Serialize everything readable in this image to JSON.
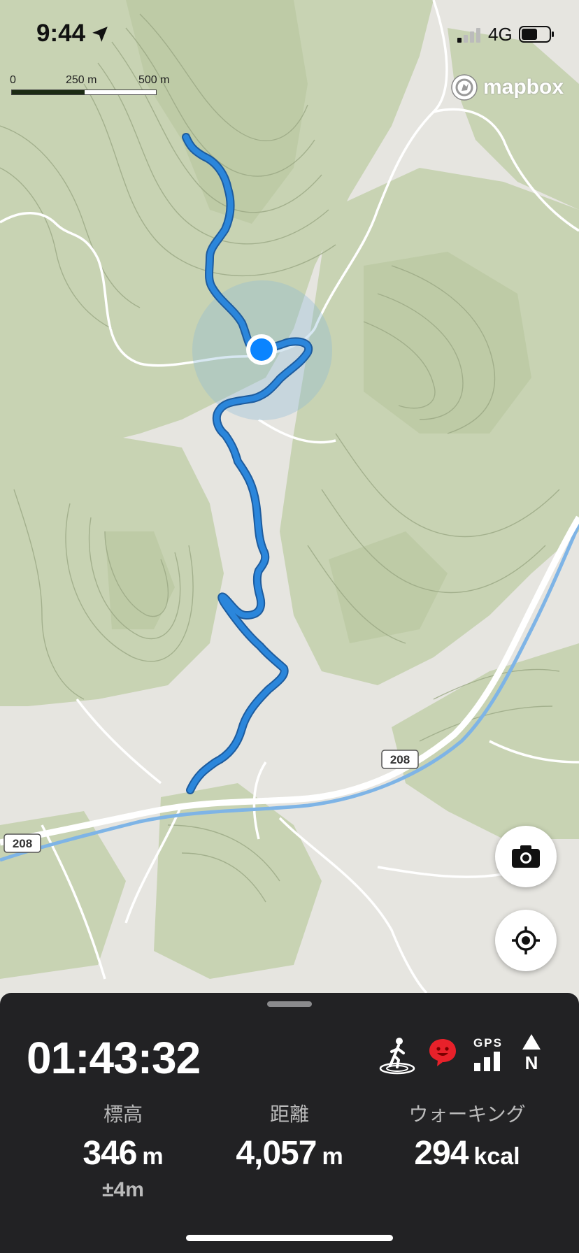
{
  "status_bar": {
    "time": "9:44",
    "network": "4G",
    "signal_bars_active": 1,
    "battery_level": 0.5
  },
  "map": {
    "scale_labels": [
      "0",
      "250 m",
      "500 m"
    ],
    "attribution": "mapbox",
    "road_labels": [
      "208",
      "208"
    ],
    "colors": {
      "route": "#2b86db",
      "location_dot": "#0a84ff",
      "forest": "#c9d4b4",
      "river": "#7eb4e6"
    }
  },
  "buttons": {
    "camera_icon": "camera-icon",
    "locate_icon": "locate-icon"
  },
  "panel": {
    "elapsed_time": "01:43:32",
    "indicators": [
      "walking-person-icon",
      "smiley-face-icon",
      "gps-signal-icon",
      "north-compass-icon"
    ],
    "gps_label": "GPS",
    "north_label": "N",
    "stats": {
      "elevation": {
        "label": "標高",
        "value": "346",
        "unit": "m",
        "accuracy": "±4m"
      },
      "distance": {
        "label": "距離",
        "value": "4,057",
        "unit": "m"
      },
      "activity": {
        "label": "ウォーキング",
        "value": "294",
        "unit": "kcal"
      }
    }
  }
}
